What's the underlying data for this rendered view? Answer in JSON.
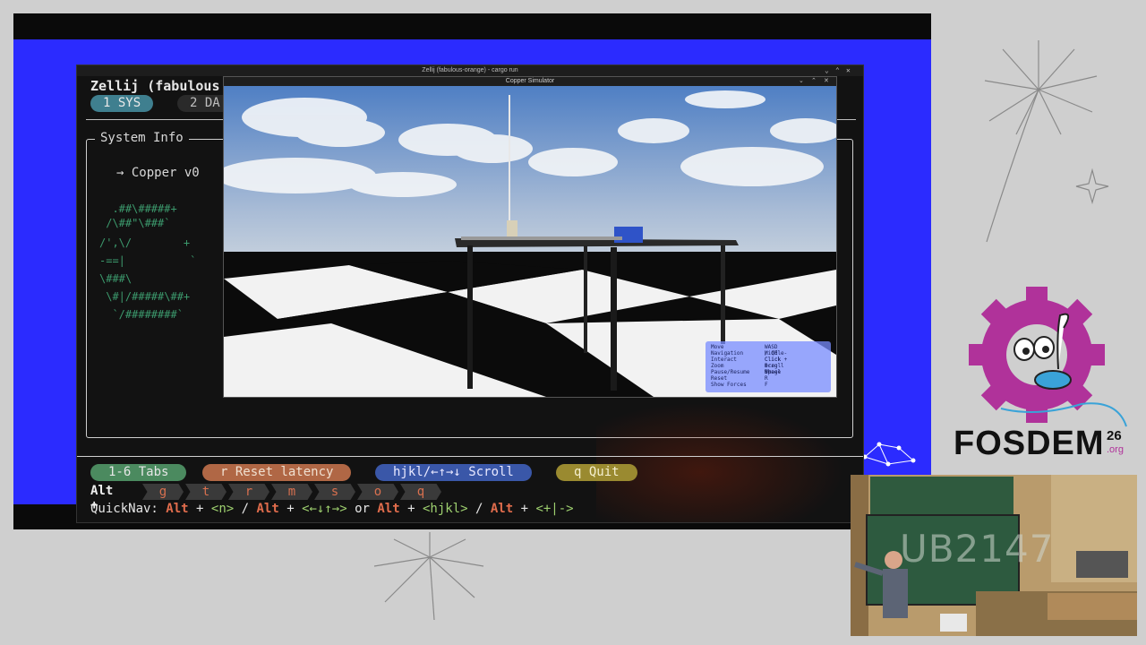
{
  "terminal": {
    "window_title": "Zellij (fabulous-orange) - cargo run",
    "app_title": "Zellij (fabulous",
    "tabs": [
      {
        "label": "1 SYS"
      },
      {
        "label": "2 DA"
      }
    ],
    "pane_title": "System Info",
    "copper_line": "→ Copper v0",
    "ascii_art": [
      "  .##\\#####+",
      " /\\##\"\\###`",
      "/',\\/        +",
      "-==|          `",
      "\\###\\",
      " \\#|/#####\\##+",
      "  `/########`"
    ],
    "status_pills": [
      {
        "label": "1-6 Tabs"
      },
      {
        "label": "r Reset latency"
      },
      {
        "label": "hjkl/←↑→↓ Scroll"
      },
      {
        "label": "q Quit"
      }
    ],
    "alt_label": "Alt +",
    "alt_keys": [
      "g",
      "t",
      "r",
      "m",
      "s",
      "o",
      "q"
    ],
    "quicknav": {
      "prefix": "QuickNav: ",
      "alt": "Alt",
      "plus": " + ",
      "n_key": "<n>",
      "sep": " / ",
      "arrows_key": "<←↓↑→>",
      "or": " or ",
      "hjkl_key": "<hjkl>",
      "plusminus_key": "<+|->"
    }
  },
  "simulator": {
    "window_title": "Copper Simulator",
    "controls": [
      {
        "label": "Move",
        "value": "WASD / QE"
      },
      {
        "label": "Navigation",
        "value": "Middle-Click + Drag"
      },
      {
        "label": "Interact",
        "value": "Click + Drag"
      },
      {
        "label": "Zoom",
        "value": "Scroll Wheel"
      },
      {
        "label": "Pause/Resume",
        "value": "Space"
      },
      {
        "label": "Reset",
        "value": "R"
      },
      {
        "label": "Show Forces",
        "value": "F"
      }
    ]
  },
  "branding": {
    "name": "FOSDEM",
    "year": "26",
    "tld": ".org"
  },
  "webcam": {
    "board_text": "UB2147"
  },
  "colors": {
    "slide_bg": "#2b2bff",
    "terminal_bg": "#121212",
    "fosdem_purple": "#b0329a"
  }
}
